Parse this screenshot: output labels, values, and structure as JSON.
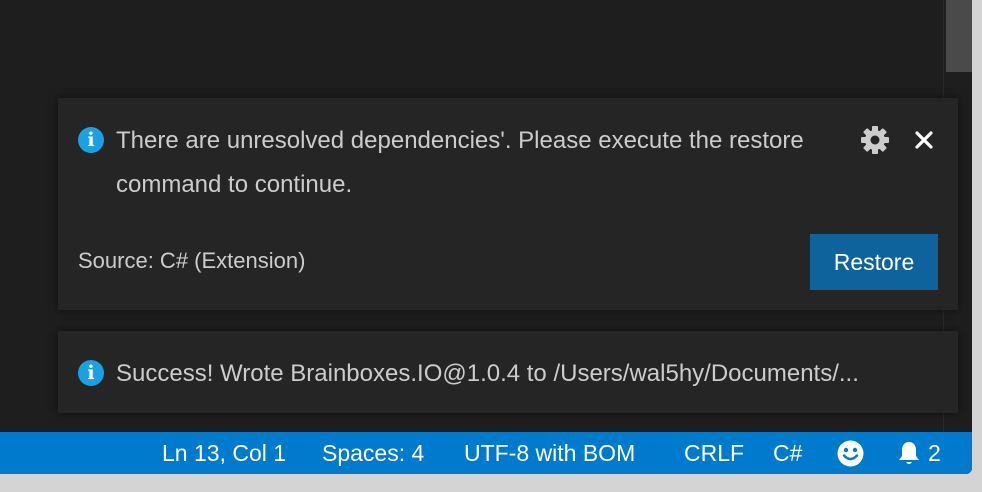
{
  "colors": {
    "editor_bg": "#1e1e1e",
    "toast_bg": "#252526",
    "accent": "#007acc",
    "button": "#0e639c",
    "info_icon": "#1ba1e2"
  },
  "notifications": [
    {
      "icon": "info-icon",
      "message": "There are unresolved dependencies'. Please execute the restore command to continue.",
      "source": "Source: C# (Extension)",
      "action_label": "Restore",
      "settings_icon": "gear-icon",
      "close_icon": "close-icon"
    },
    {
      "icon": "info-icon",
      "message": "Success! Wrote Brainboxes.IO@1.0.4 to /Users/wal5hy/Documents/..."
    }
  ],
  "statusbar": {
    "position": "Ln 13, Col 1",
    "indentation": "Spaces: 4",
    "encoding": "UTF-8 with BOM",
    "line_ending": "CRLF",
    "language": "C#",
    "feedback_icon": "smiley-icon",
    "bell_icon": "bell-icon",
    "notification_count": "2"
  }
}
